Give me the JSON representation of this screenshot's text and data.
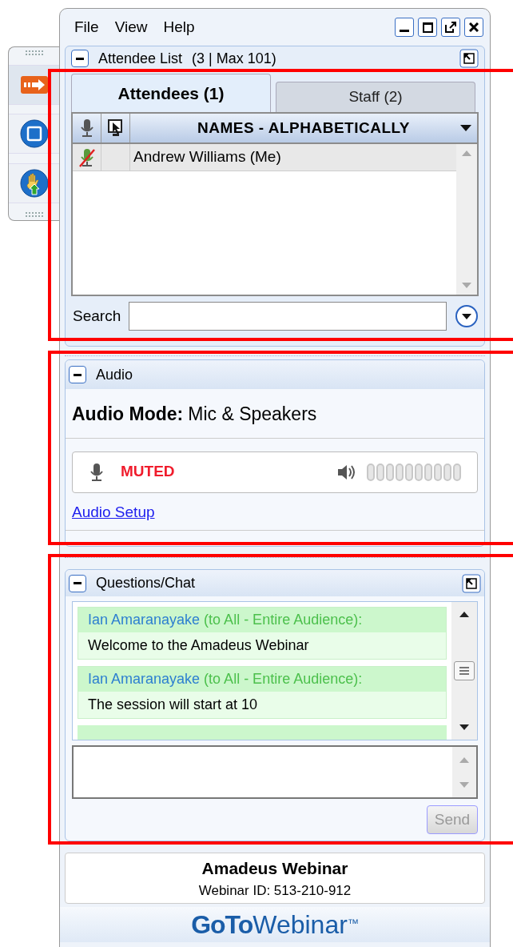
{
  "side_toolbar": [
    {
      "kind": "arrow",
      "selected": true
    },
    {
      "kind": "screen",
      "selected": false
    },
    {
      "kind": "hand",
      "selected": false
    }
  ],
  "menu": [
    "File",
    "View",
    "Help"
  ],
  "attendee_list": {
    "title": "Attendee List",
    "count": "(3 | Max 101)",
    "tabs": [
      {
        "label": "Attendees (1)",
        "selected": true
      },
      {
        "label": "Staff (2)",
        "selected": false
      }
    ],
    "column_header": "NAMES - ALPHABETICALLY",
    "rows": [
      {
        "name": "Andrew Williams (Me)",
        "muted": true,
        "selected": true
      }
    ],
    "search": {
      "label": "Search"
    }
  },
  "audio": {
    "title": "Audio",
    "mode_label": "Audio Mode:",
    "mode_value": "Mic & Speakers",
    "mic_status": "MUTED",
    "speaker": {
      "level": 0
    },
    "link": "Audio Setup"
  },
  "chat": {
    "title": "Questions/Chat",
    "messages": [
      {
        "sender": "Ian Amaranayake",
        "recipient": "(to All - Entire Audience):",
        "text": "Welcome to the Amadeus Webinar"
      },
      {
        "sender": "Ian Amaranayake",
        "recipient": "(to All - Entire Audience):",
        "text": "The session will start at 10"
      }
    ],
    "send_button": {
      "label": "Send",
      "disabled": true
    }
  },
  "footer": {
    "title": "Amadeus Webinar",
    "webinar_id": "Webinar ID: 513-210-912",
    "logo_bold": "GoTo",
    "logo_light": "Webinar",
    "logo_mark": "™"
  }
}
